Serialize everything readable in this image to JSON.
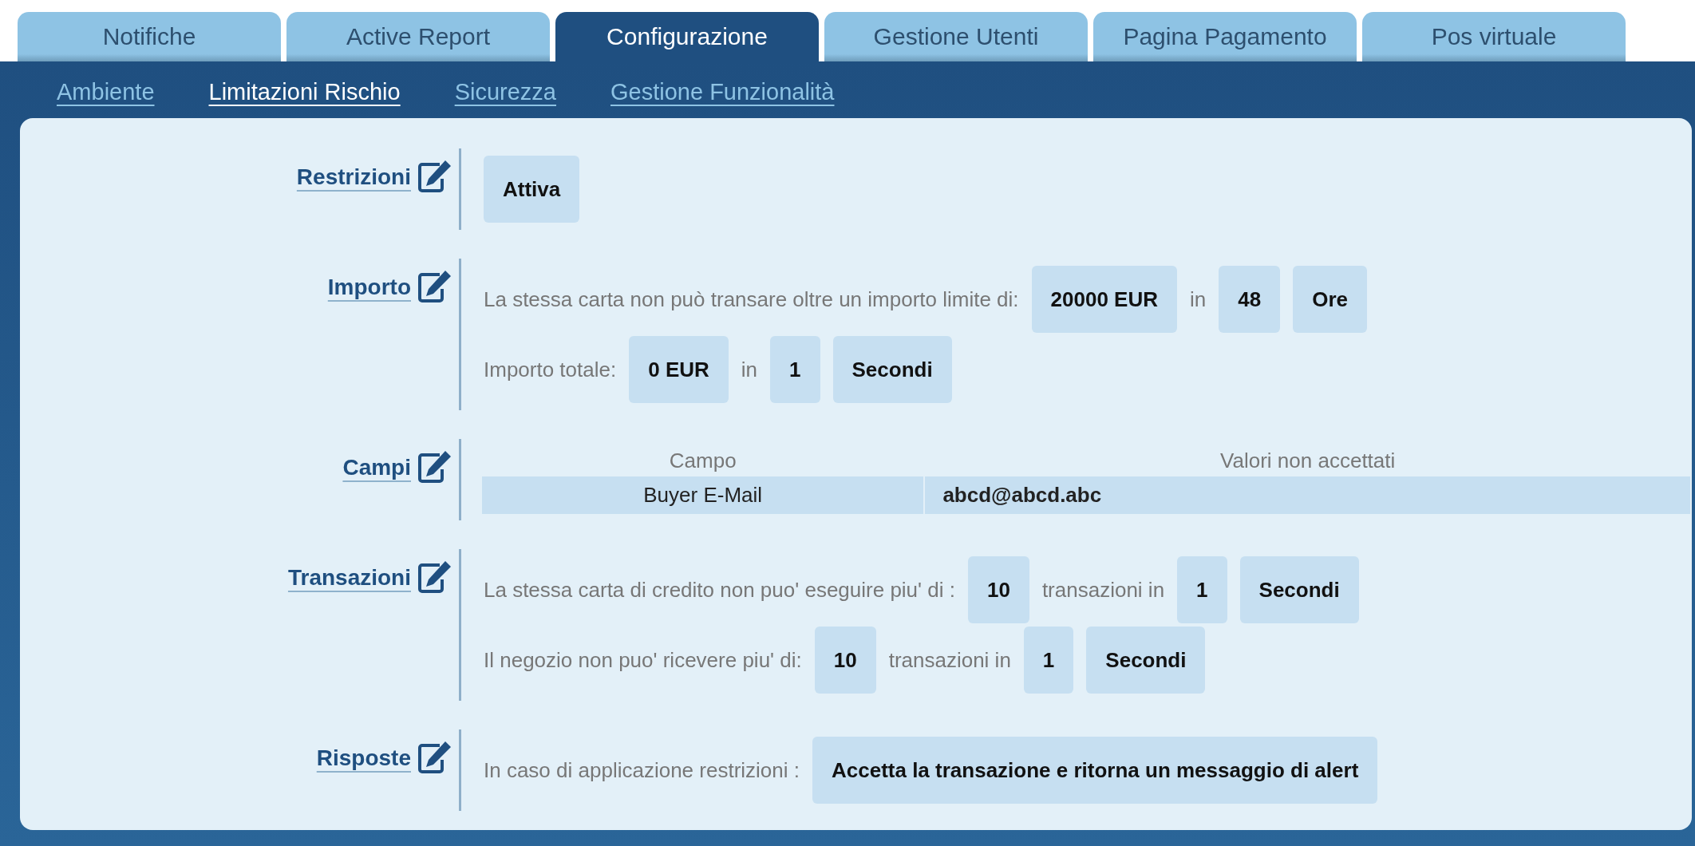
{
  "tabs": [
    {
      "label": "Notifiche",
      "selected": false
    },
    {
      "label": "Active Report",
      "selected": false
    },
    {
      "label": "Configurazione",
      "selected": true
    },
    {
      "label": "Gestione Utenti",
      "selected": false
    },
    {
      "label": "Pagina Pagamento",
      "selected": false
    },
    {
      "label": "Pos virtuale",
      "selected": false
    }
  ],
  "subnav": [
    {
      "label": "Ambiente",
      "selected": false
    },
    {
      "label": "Limitazioni Rischio",
      "selected": true
    },
    {
      "label": "Sicurezza",
      "selected": false
    },
    {
      "label": "Gestione Funzionalità",
      "selected": false
    }
  ],
  "sections": [
    {
      "label": "Restrizioni",
      "kind": "lines",
      "lines": [
        [
          {
            "kind": "value",
            "text": "Attiva"
          }
        ]
      ]
    },
    {
      "label": "Importo",
      "kind": "lines",
      "lines": [
        [
          {
            "kind": "text",
            "text": "La stessa carta non può transare oltre un importo limite di:"
          },
          {
            "kind": "value",
            "text": "20000 EUR"
          },
          {
            "kind": "text",
            "text": "in"
          },
          {
            "kind": "value",
            "text": "48"
          },
          {
            "kind": "value",
            "text": "Ore"
          }
        ],
        [
          {
            "kind": "text",
            "text": "Importo totale:"
          },
          {
            "kind": "value",
            "text": "0 EUR"
          },
          {
            "kind": "text",
            "text": "in"
          },
          {
            "kind": "value",
            "text": "1"
          },
          {
            "kind": "value",
            "text": "Secondi"
          }
        ]
      ]
    },
    {
      "label": "Campi",
      "kind": "table",
      "columns": [
        "Campo",
        "Valori non accettati"
      ],
      "rows": [
        [
          "Buyer E-Mail",
          "abcd@abcd.abc"
        ]
      ]
    },
    {
      "label": "Transazioni",
      "kind": "lines",
      "lines": [
        [
          {
            "kind": "text",
            "text": "La stessa carta di credito non puo' eseguire piu' di :"
          },
          {
            "kind": "value",
            "text": "10"
          },
          {
            "kind": "text",
            "text": "transazioni in"
          },
          {
            "kind": "value",
            "text": "1"
          },
          {
            "kind": "value",
            "text": "Secondi"
          }
        ],
        [
          {
            "kind": "text",
            "text": "Il negozio non puo' ricevere piu' di:"
          },
          {
            "kind": "value",
            "text": "10"
          },
          {
            "kind": "text",
            "text": "transazioni in"
          },
          {
            "kind": "value",
            "text": "1"
          },
          {
            "kind": "value",
            "text": "Secondi"
          }
        ]
      ]
    },
    {
      "label": "Risposte",
      "kind": "lines",
      "lines": [
        [
          {
            "kind": "text",
            "text": "In caso di applicazione restrizioni :"
          },
          {
            "kind": "value",
            "text": "Accetta la transazione e ritorna un messaggio di alert"
          }
        ]
      ]
    }
  ]
}
